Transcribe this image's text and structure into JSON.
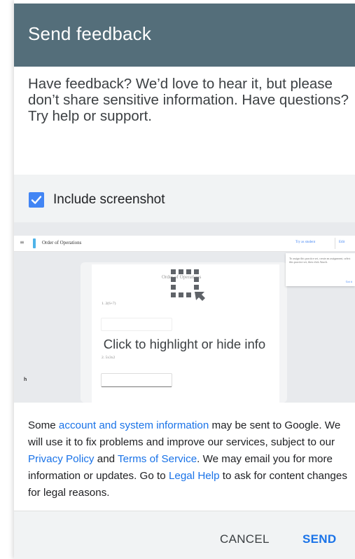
{
  "header": {
    "title": "Send feedback"
  },
  "prompt_text": "Have feedback? We’d love to hear it, but please don’t share sensitive information. Have questions? Try help or support.",
  "screenshot": {
    "include_label": "Include screenshot",
    "include_checked": true,
    "highlight_text": "Click to highlight or hide info",
    "preview": {
      "menu_glyph": "≡",
      "page_title": "Order of Operations",
      "try_as_student": "Try as student",
      "edit": "Edit",
      "card_title": "Order of Operations",
      "question_1": "1.  2(6+7)",
      "question_2": "2.  5x3x2",
      "side_note": "To assign this practice set, create an assignment, select this practice set, then click Attach.",
      "side_link": "Got it",
      "bottom_letter": "h"
    }
  },
  "info": {
    "part1": "Some ",
    "link_account": "account and system information",
    "part2": " may be sent to Google. We will use it to fix problems and improve our services, subject to our ",
    "link_privacy": "Privacy Policy",
    "part3": " and ",
    "link_terms": "Terms of Service",
    "part4": ". We may email you for more information or updates. Go to ",
    "link_legal": "Legal Help",
    "part5": " to ask for content changes for legal reasons."
  },
  "footer": {
    "cancel_label": "CANCEL",
    "send_label": "SEND"
  },
  "colors": {
    "header_bg": "#546e7a",
    "accent": "#1a73e8",
    "checkbox": "#4285f4"
  }
}
